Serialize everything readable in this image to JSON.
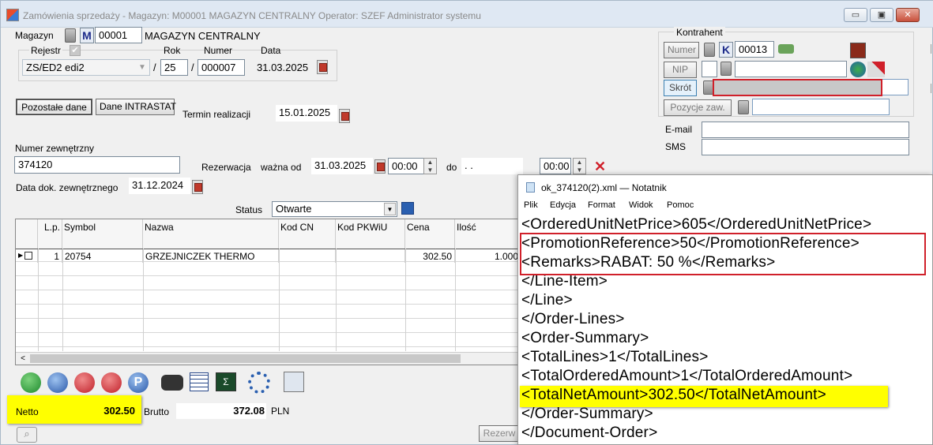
{
  "window": {
    "title": "Zamówienia sprzedaży - Magazyn: M00001 MAGAZYN CENTRALNY  Operator: SZEF Administrator systemu",
    "buttons": {
      "minimize": "▭",
      "restore": "▣",
      "close": "✕"
    }
  },
  "magazyn": {
    "label": "Magazyn",
    "letter": "M",
    "code": "00001",
    "name": "MAGAZYN CENTRALNY"
  },
  "doc": {
    "rejestr_label": "Rejestr",
    "rok_label": "Rok",
    "numer_label": "Numer",
    "data_label": "Data",
    "rejestr_value": "ZS/ED2 edi2",
    "rok_value": "25",
    "numer_value": "000007",
    "data_value": "31.03.2025",
    "slash": "/"
  },
  "kontrahent": {
    "group_label": "Kontrahent",
    "numer_btn": "Numer",
    "letter": "K",
    "numer_value": "00013",
    "nip_btn": "NIP",
    "skrot_btn": "Skrót",
    "pozycje_btn": "Pozycje zaw.",
    "email_label": "E-mail",
    "sms_label": "SMS"
  },
  "tabs": {
    "pozostale": "Pozostałe dane",
    "intrastat": "Dane INTRASTAT"
  },
  "termin": {
    "label": "Termin realizacji",
    "value": "15.01.2025"
  },
  "numer_zewn": {
    "label": "Numer zewnętrzny",
    "value": "374120"
  },
  "rezerwacja": {
    "label": "Rezerwacja",
    "wazna_od": "ważna od",
    "od_date": "31.03.2025",
    "od_time": "00:00",
    "do_label": "do",
    "do_date": ". .",
    "do_time": "00:00"
  },
  "data_dok": {
    "label": "Data dok. zewnętrznego",
    "value": "31.12.2024"
  },
  "status": {
    "label": "Status",
    "value": "Otwarte"
  },
  "grid": {
    "columns": [
      "L.p.",
      "Symbol",
      "Nazwa",
      "Kod CN",
      "Kod PKWiU",
      "Cena",
      "Ilość"
    ],
    "rows": [
      {
        "lp": "1",
        "symbol": "20754",
        "nazwa": "GRZEJNICZEK THERMO",
        "kodcn": "",
        "pkwiu": "",
        "cena": "302.50",
        "ilosc": "1.000"
      }
    ]
  },
  "totals": {
    "netto_label": "Netto",
    "netto": "302.50",
    "brutto_label": "Brutto",
    "brutto": "372.08",
    "currency": "PLN"
  },
  "bottom": {
    "rezerw_btn": "Rezerw"
  },
  "notepad": {
    "title": "ok_374120(2).xml — Notatnik",
    "menu": [
      "Plik",
      "Edycja",
      "Format",
      "Widok",
      "Pomoc"
    ],
    "lines": [
      "<OrderedUnitNetPrice>605</OrderedUnitNetPrice>",
      "<PromotionReference>50</PromotionReference>",
      "<Remarks>RABAT: 50 %</Remarks>",
      "</Line-Item>",
      "</Line>",
      "</Order-Lines>",
      "<Order-Summary>",
      "<TotalLines>1</TotalLines>",
      "<TotalOrderedAmount>1</TotalOrderedAmount>",
      "<TotalNetAmount>302.50</TotalNetAmount>",
      "</Order-Summary>",
      "</Document-Order>"
    ]
  },
  "colors": {
    "highlight": "#ffff00",
    "annotation": "#d0202a"
  }
}
